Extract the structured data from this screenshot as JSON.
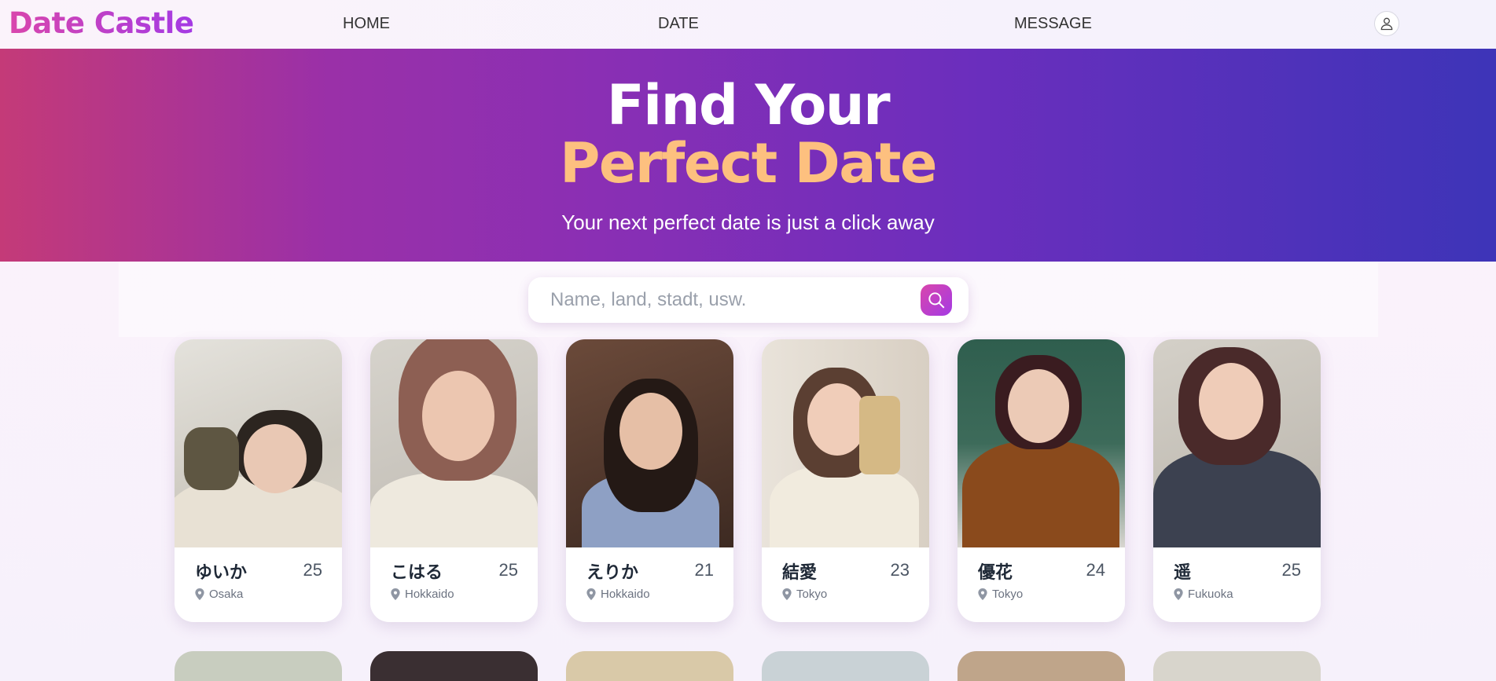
{
  "nav": {
    "logo": "Date Castle",
    "links": [
      "HOME",
      "DATE",
      "MESSAGE"
    ],
    "user_icon": "user-icon"
  },
  "hero": {
    "line1": "Find Your",
    "line2": "Perfect Date",
    "subtitle": "Your next perfect date is just a click away"
  },
  "search": {
    "placeholder": "Name, land, stadt, usw.",
    "value": "",
    "icon": "search-icon"
  },
  "profiles": [
    {
      "name": "ゆいか",
      "age": "25",
      "location": "Osaka"
    },
    {
      "name": "こはる",
      "age": "25",
      "location": "Hokkaido"
    },
    {
      "name": "えりか",
      "age": "21",
      "location": "Hokkaido"
    },
    {
      "name": "結愛",
      "age": "23",
      "location": "Tokyo"
    },
    {
      "name": "優花",
      "age": "24",
      "location": "Tokyo"
    },
    {
      "name": "遥",
      "age": "25",
      "location": "Fukuoka"
    }
  ],
  "colors": {
    "brand_gradient_start": "#d946ac",
    "brand_gradient_end": "#a43ae4",
    "hero_accent": "#fdc07f"
  }
}
